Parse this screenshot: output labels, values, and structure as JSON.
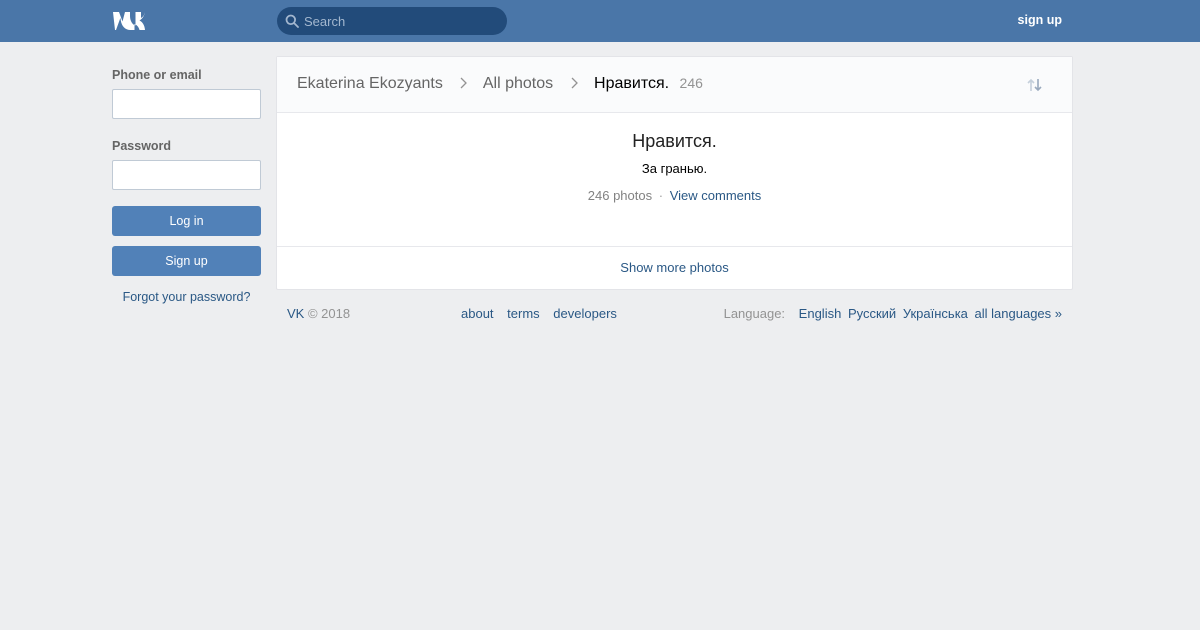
{
  "header": {
    "logo_alt": "VK",
    "search_placeholder": "Search",
    "signup_label": "sign up"
  },
  "login": {
    "phone_label": "Phone or email",
    "password_label": "Password",
    "login_button": "Log in",
    "signup_button": "Sign up",
    "forgot_link": "Forgot your password?"
  },
  "breadcrumb": {
    "owner": "Ekaterina Ekozyants",
    "all_photos": "All photos",
    "album": "Нравится.",
    "count": "246"
  },
  "album": {
    "title": "Нравится.",
    "description": "За гранью.",
    "photo_count": "246 photos",
    "separator": "·",
    "view_comments": "View comments"
  },
  "show_more": "Show more photos",
  "footer": {
    "brand": "VK",
    "copyright": "© 2018",
    "links": [
      "about",
      "terms",
      "developers"
    ],
    "language_label": "Language:",
    "languages": [
      "English",
      "Русский",
      "Українська",
      "all languages »"
    ]
  },
  "colors": {
    "header_bg": "#4a76a8",
    "page_bg": "#edeef0",
    "button_bg": "#5181b8",
    "link": "#2a5885"
  },
  "icons": {
    "logo": "vk-logo",
    "search": "search-icon",
    "breadcrumb_separator": "chevron-right-icon",
    "sort": "sort-arrows-icon"
  }
}
